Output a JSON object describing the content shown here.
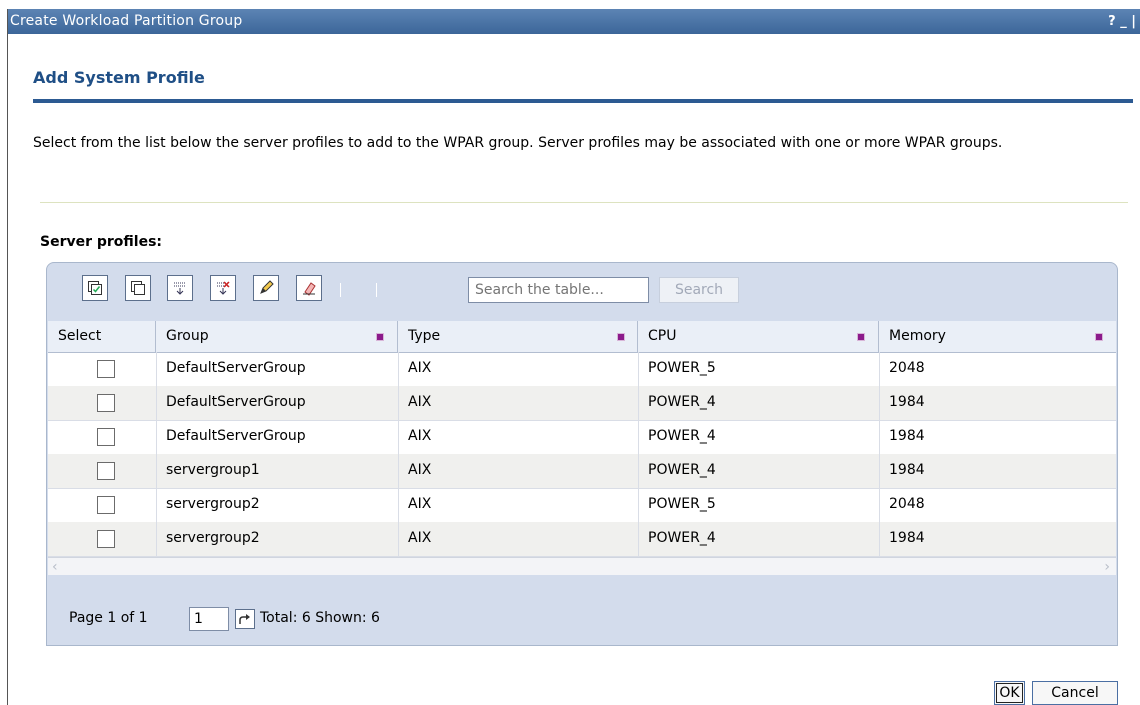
{
  "window": {
    "title": "Create Workload Partition Group",
    "controls": "? _ |"
  },
  "page": {
    "heading": "Add System Profile",
    "description": "Select from the list below the server profiles to add to the WPAR group. Server profiles may be associated with one or more WPAR groups.",
    "section_label": "Server profiles:"
  },
  "toolbar": {
    "icons": [
      "select-all-icon",
      "deselect-all-icon",
      "show-filter-row-icon",
      "clear-all-filters-icon",
      "edit-sort-icon",
      "clear-all-sorts-icon"
    ]
  },
  "search": {
    "placeholder": "Search the table...",
    "button_label": "Search"
  },
  "table": {
    "columns": [
      "Select",
      "Group",
      "Type",
      "CPU",
      "Memory"
    ],
    "rows": [
      {
        "group": "DefaultServerGroup",
        "type": "AIX",
        "cpu": "POWER_5",
        "memory": "2048"
      },
      {
        "group": "DefaultServerGroup",
        "type": "AIX",
        "cpu": "POWER_4",
        "memory": "1984"
      },
      {
        "group": "DefaultServerGroup",
        "type": "AIX",
        "cpu": "POWER_4",
        "memory": "1984"
      },
      {
        "group": "servergroup1",
        "type": "AIX",
        "cpu": "POWER_4",
        "memory": "1984"
      },
      {
        "group": "servergroup2",
        "type": "AIX",
        "cpu": "POWER_5",
        "memory": "2048"
      },
      {
        "group": "servergroup2",
        "type": "AIX",
        "cpu": "POWER_4",
        "memory": "1984"
      }
    ]
  },
  "pagination": {
    "page_label": "Page 1 of 1",
    "page_value": "1",
    "totals": "Total: 6 Shown: 6"
  },
  "buttons": {
    "ok": "OK",
    "cancel": "Cancel"
  },
  "colors": {
    "title_bar": "#3c6699",
    "heading": "#1f4f86",
    "panel": "#d3dcec",
    "sort_marker": "#8b1a8b"
  }
}
